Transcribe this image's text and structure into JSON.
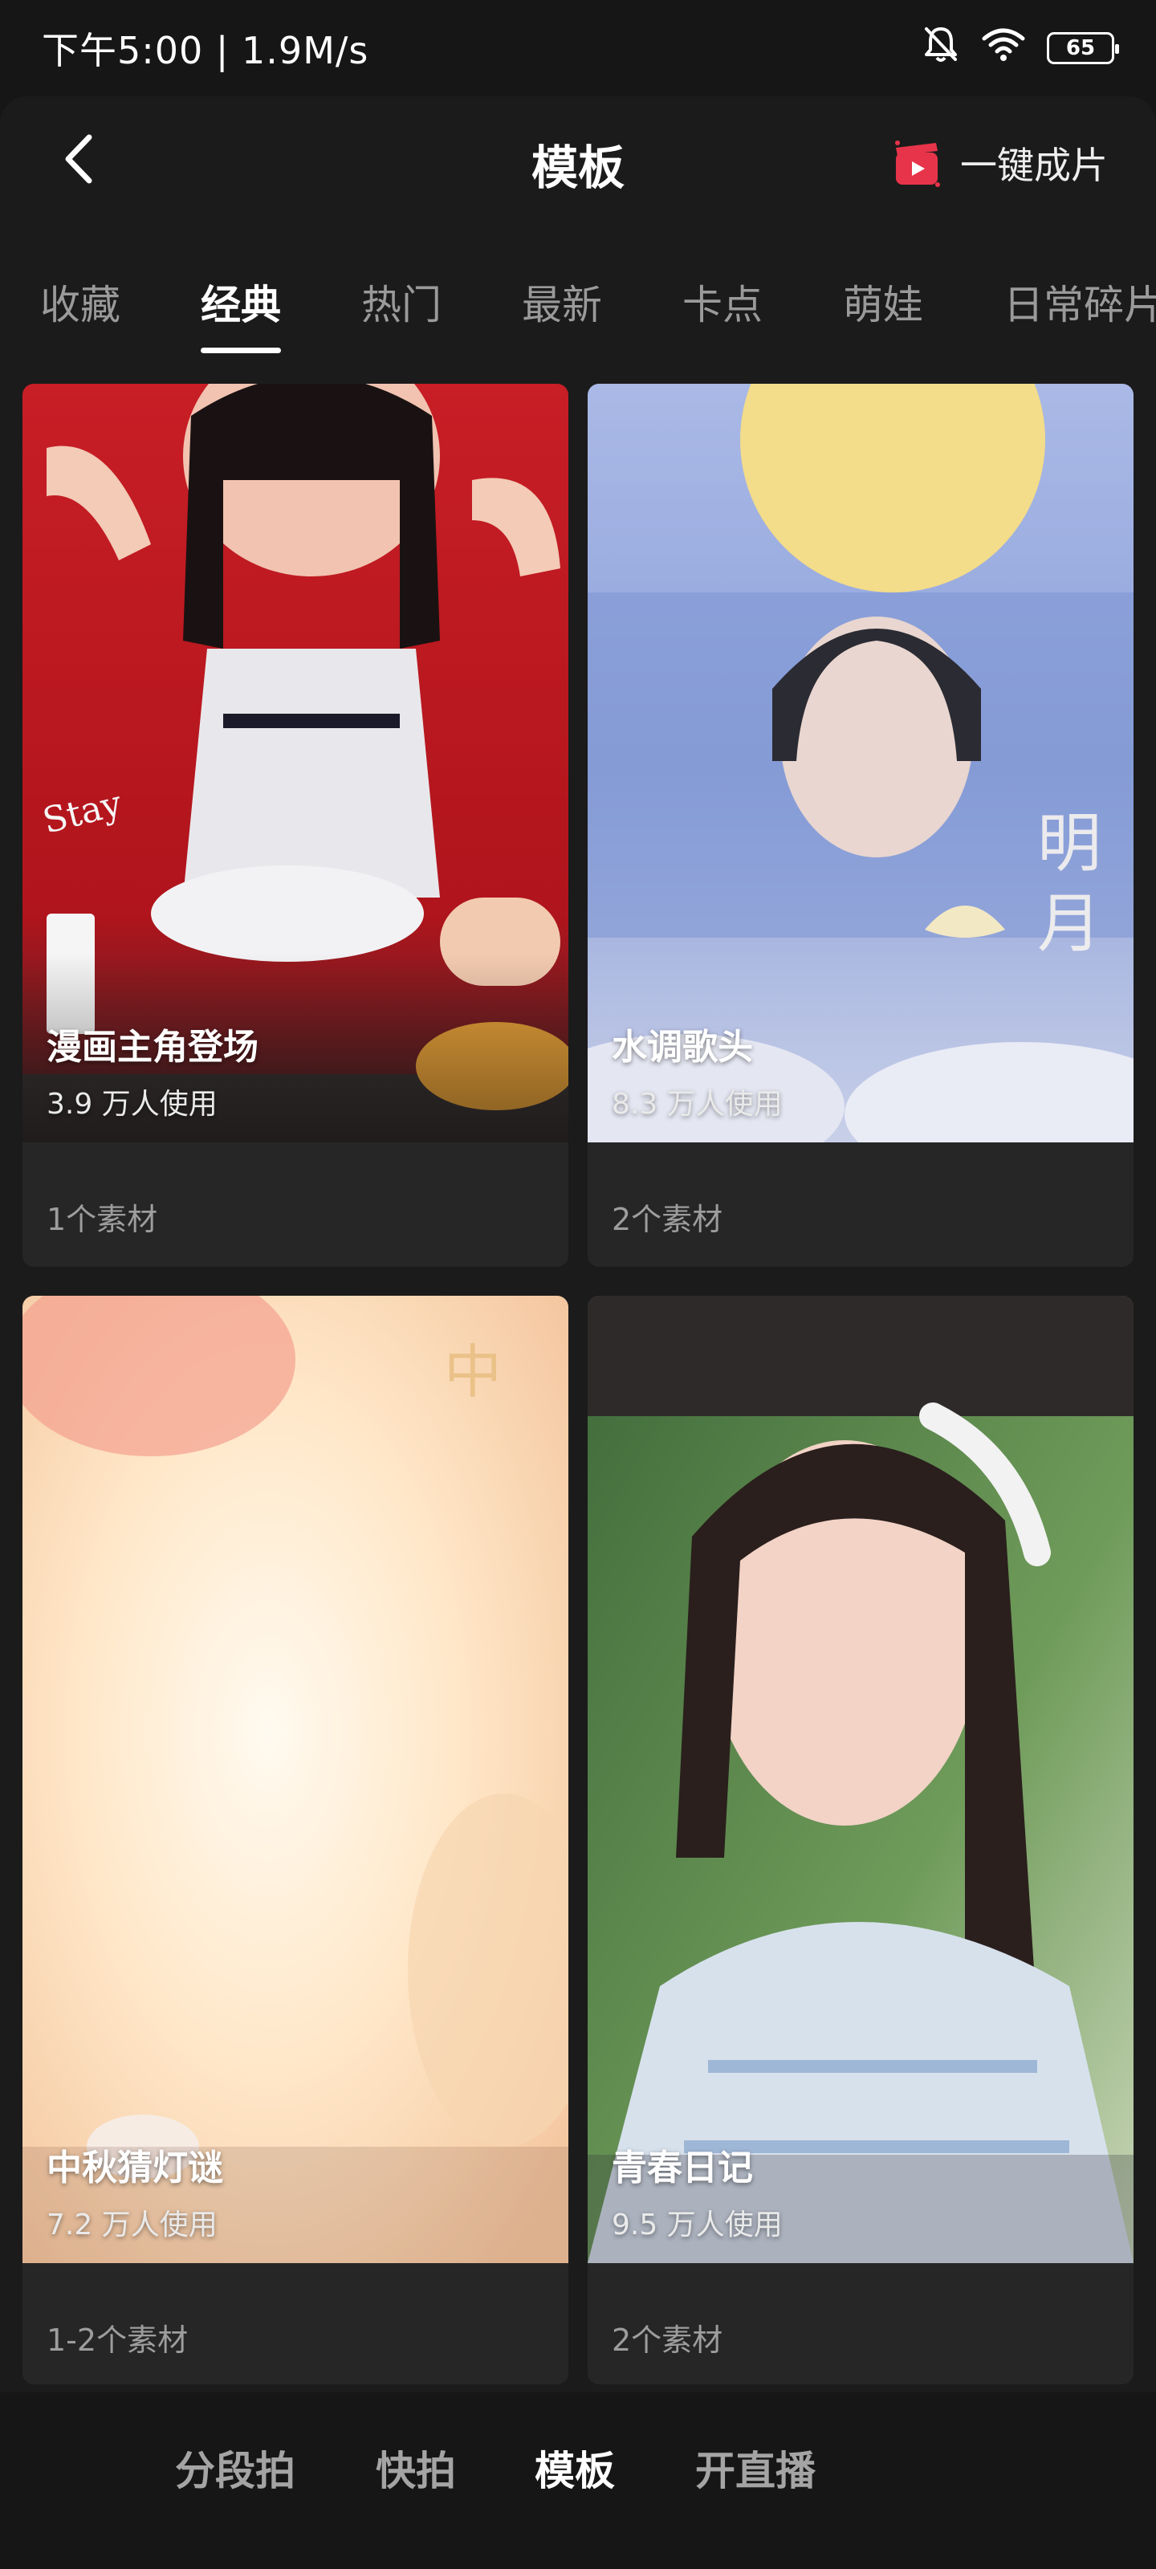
{
  "statusbar": {
    "time_text": "下午5:00 | 1.9M/s",
    "battery_level": "65"
  },
  "header": {
    "title": "模板",
    "one_click_label": "一键成片"
  },
  "tabs": [
    {
      "label": "收藏"
    },
    {
      "label": "经典"
    },
    {
      "label": "热门"
    },
    {
      "label": "最新"
    },
    {
      "label": "卡点"
    },
    {
      "label": "萌娃"
    },
    {
      "label": "日常碎片"
    }
  ],
  "active_tab": "经典",
  "templates": [
    {
      "title": "漫画主角登场",
      "uses": "3.9 万人使用",
      "materials": "1个素材"
    },
    {
      "title": "水调歌头",
      "uses": "8.3 万人使用",
      "materials": "2个素材"
    },
    {
      "title": "中秋猜灯谜",
      "uses": "7.2 万人使用",
      "materials": "1-2个素材"
    },
    {
      "title": "青春日记",
      "uses": "9.5 万人使用",
      "materials": "2个素材"
    }
  ],
  "bottom_nav": [
    {
      "label": "分段拍"
    },
    {
      "label": "快拍"
    },
    {
      "label": "模板"
    },
    {
      "label": "开直播"
    }
  ],
  "active_bottom_nav": "模板",
  "colors": {
    "background": "#161616",
    "panel": "#1b1b1b",
    "card": "#262626",
    "accent": "#e7344a"
  },
  "icons": {
    "back": "back-arrow-icon",
    "one_click": "clapperboard-icon",
    "mute": "bell-off-icon",
    "wifi": "wifi-icon",
    "battery": "battery-icon"
  }
}
